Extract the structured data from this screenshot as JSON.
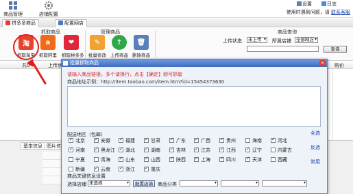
{
  "toolbar": {
    "items": [
      {
        "label": "商品管理",
        "icon": "grid-icon"
      },
      {
        "label": "店铺配置",
        "icon": "gear-icon"
      }
    ],
    "right": {
      "settings_label": "设置",
      "log_label": "日志",
      "help_text": "使用时遇到问题，请",
      "contact_link": "联系客服"
    }
  },
  "tabs": [
    {
      "label": "拼多多商品"
    },
    {
      "label": "配置网店"
    }
  ],
  "ribbon": {
    "groups": [
      {
        "title": "抓取商品"
      },
      {
        "title": "管理商品"
      },
      {
        "title": "商品查询"
      }
    ],
    "buttons": [
      {
        "label": "抓取淘宝",
        "icon_text": "淘",
        "color": "#e8442b"
      },
      {
        "label": "抓取阿里",
        "icon_text": "a",
        "color": "#f06a1a"
      },
      {
        "label": "抓取拼多多",
        "icon_text": "❤",
        "color": "#e0283c"
      },
      {
        "label": "批量修改",
        "icon_text": "✎",
        "color": "#f2a233"
      },
      {
        "label": "上传商品",
        "icon_text": "↑",
        "color": "#2fa84a"
      },
      {
        "label": "删除商品",
        "icon_text": "🗑",
        "color": "#5b7fb8"
      }
    ],
    "query": {
      "upload_status_label": "上传状态",
      "upload_status_value": "未上传",
      "shop_label": "所属店铺",
      "shop_value": "全部网店",
      "query_button": "查询"
    }
  },
  "grid": {
    "headers": [
      "共0",
      "上传状"
    ],
    "right_header": "购价"
  },
  "bottom_panel": {
    "tabs": [
      "基本信息",
      "图片信"
    ]
  },
  "dialog": {
    "title": "批量抓取商品",
    "hint": "请输入商品链接，多个请换行，点击【确定】即可抓取",
    "example": "商品地址示例：http://item.taobao.com/item.htm?id=15454373630",
    "region_title": "配送地区（包邮）",
    "regions": [
      {
        "name": "北京",
        "checked": true
      },
      {
        "name": "安徽",
        "checked": true
      },
      {
        "name": "福建",
        "checked": true
      },
      {
        "name": "甘肃",
        "checked": true
      },
      {
        "name": "广东",
        "checked": true
      },
      {
        "name": "广西",
        "checked": true
      },
      {
        "name": "贵州",
        "checked": true
      },
      {
        "name": "海南",
        "checked": false
      },
      {
        "name": "河北",
        "checked": true
      },
      {
        "name": "河南",
        "checked": true
      },
      {
        "name": "黑龙江",
        "checked": true
      },
      {
        "name": "湖北",
        "checked": true
      },
      {
        "name": "湖南",
        "checked": true
      },
      {
        "name": "吉林",
        "checked": true
      },
      {
        "name": "江苏",
        "checked": true
      },
      {
        "name": "江西",
        "checked": true
      },
      {
        "name": "辽宁",
        "checked": true
      },
      {
        "name": "内蒙古",
        "checked": false
      },
      {
        "name": "宁夏",
        "checked": false
      },
      {
        "name": "青海",
        "checked": false
      },
      {
        "name": "山东",
        "checked": true
      },
      {
        "name": "山西",
        "checked": true
      },
      {
        "name": "陕西",
        "checked": true
      },
      {
        "name": "上海",
        "checked": true
      },
      {
        "name": "四川",
        "checked": true
      },
      {
        "name": "天津",
        "checked": true
      },
      {
        "name": "西藏",
        "checked": false
      },
      {
        "name": "新疆",
        "checked": false
      },
      {
        "name": "云南",
        "checked": true
      },
      {
        "name": "浙江",
        "checked": true
      },
      {
        "name": "重庆",
        "checked": true
      }
    ],
    "links": {
      "select_all": "全选",
      "invert": "反选",
      "common": "常用"
    },
    "shop_section": {
      "title": "商品关键信息设置",
      "select_shop_label": "选择店铺",
      "select_shop_value": "未选择",
      "config_button": "配置店铺",
      "category_label": "商品分类"
    },
    "close_symbol": "×"
  }
}
